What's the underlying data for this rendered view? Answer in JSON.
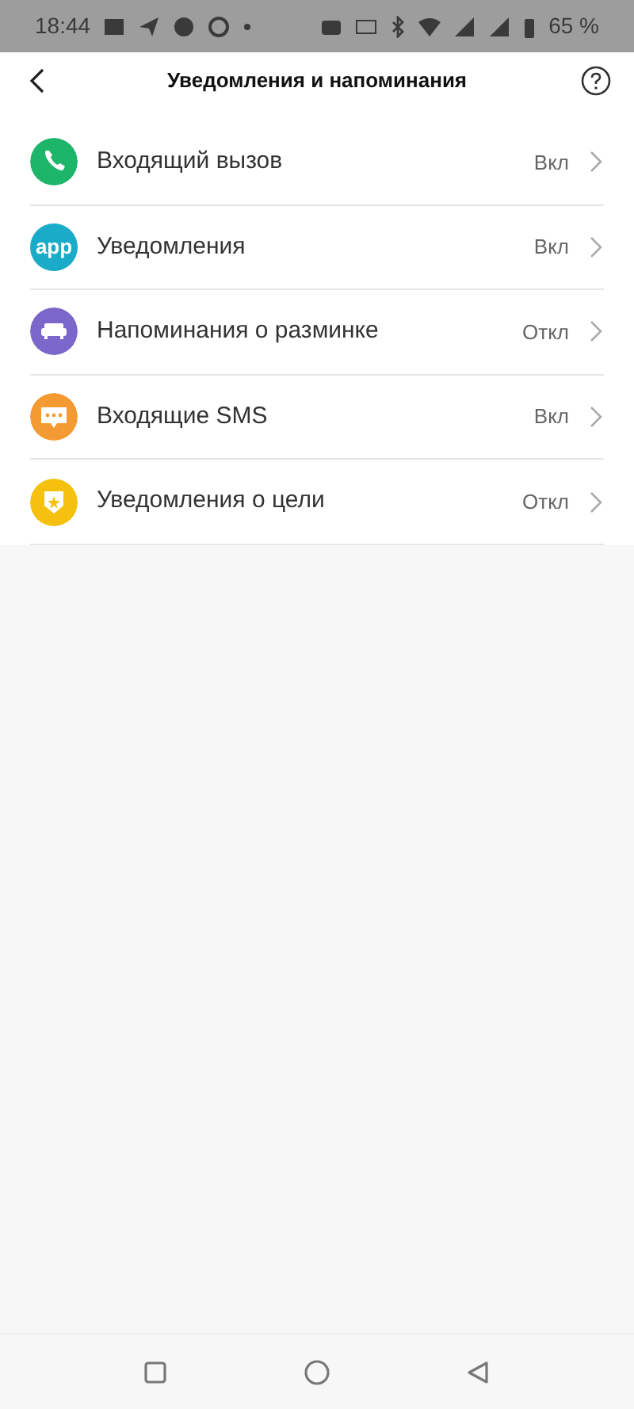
{
  "status_bar": {
    "time": "18:44",
    "battery": "65 %"
  },
  "header": {
    "title": "Уведомления и напоминания"
  },
  "items": [
    {
      "label": "Входящий вызов",
      "value": "Вкл",
      "kind": "phone",
      "color": "#1db56a"
    },
    {
      "label": "Уведомления",
      "value": "Вкл",
      "kind": "app",
      "icon_text": "app",
      "color": "#1aabc9"
    },
    {
      "label": "Напоминания о разминке",
      "value": "Откл",
      "kind": "sofa",
      "color": "#7a67c9"
    },
    {
      "label": "Входящие SMS",
      "value": "Вкл",
      "kind": "sms",
      "color": "#f39a33"
    },
    {
      "label": "Уведомления о цели",
      "value": "Откл",
      "kind": "goal",
      "color": "#f5c10e"
    }
  ]
}
